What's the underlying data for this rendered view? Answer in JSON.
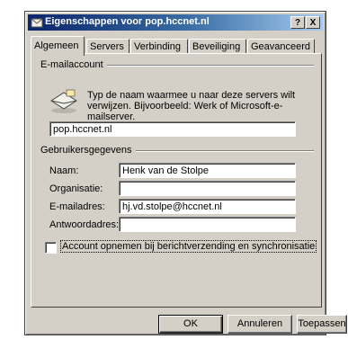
{
  "window": {
    "title": "Eigenschappen voor pop.hccnet.nl",
    "help_label": "?",
    "close_label": "X"
  },
  "tabs": [
    {
      "label": "Algemeen",
      "active": true
    },
    {
      "label": "Servers",
      "active": false
    },
    {
      "label": "Verbinding",
      "active": false
    },
    {
      "label": "Beveiliging",
      "active": false
    },
    {
      "label": "Geavanceerd",
      "active": false
    }
  ],
  "email_account": {
    "group_label": "E-mailaccount",
    "description": "Typ de naam waarmee u naar deze servers wilt verwijzen. Bijvoorbeeld: Werk of Microsoft-e-mailserver.",
    "account_name": "pop.hccnet.nl"
  },
  "user_info": {
    "group_label": "Gebruikersgegevens",
    "fields": [
      {
        "label": "Naam:",
        "value": "Henk van de Stolpe"
      },
      {
        "label": "Organisatie:",
        "value": ""
      },
      {
        "label": "E-mailadres:",
        "value": "hj.vd.stolpe@hccnet.nl"
      },
      {
        "label": "Antwoordadres:",
        "value": ""
      }
    ]
  },
  "checkbox": {
    "label": "Account opnemen bij berichtverzending en synchronisatie",
    "checked": false
  },
  "buttons": {
    "ok": "OK",
    "cancel": "Annuleren",
    "apply": "Toepassen"
  }
}
